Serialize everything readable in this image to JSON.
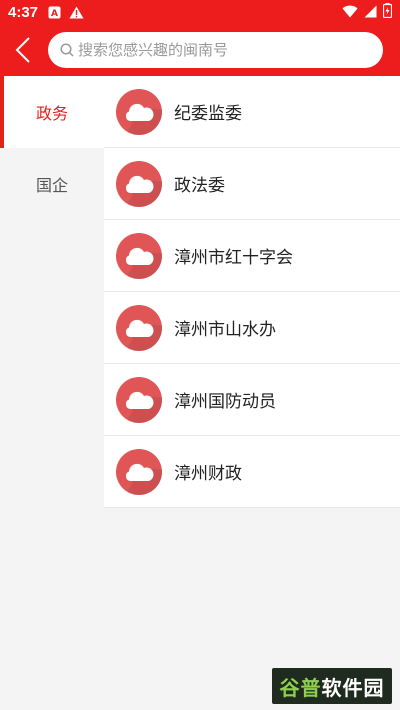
{
  "status_bar": {
    "time": "4:37"
  },
  "search": {
    "placeholder": "搜索您感兴趣的闽南号"
  },
  "sidebar": {
    "tabs": [
      {
        "label": "政务",
        "active": true
      },
      {
        "label": "国企",
        "active": false
      }
    ]
  },
  "list": {
    "items": [
      {
        "label": "纪委监委",
        "icon": "cloud-icon"
      },
      {
        "label": "政法委",
        "icon": "cloud-icon"
      },
      {
        "label": "漳州市红十字会",
        "icon": "cloud-icon"
      },
      {
        "label": "漳州市山水办",
        "icon": "cloud-icon"
      },
      {
        "label": "漳州国防动员",
        "icon": "cloud-icon"
      },
      {
        "label": "漳州财政",
        "icon": "cloud-icon"
      }
    ]
  },
  "watermark": {
    "part1": "谷普",
    "part2": "软件园"
  },
  "colors": {
    "brand_red": "#ee1d1d",
    "active_red": "#e2231a",
    "avatar_red": "#e05656"
  }
}
